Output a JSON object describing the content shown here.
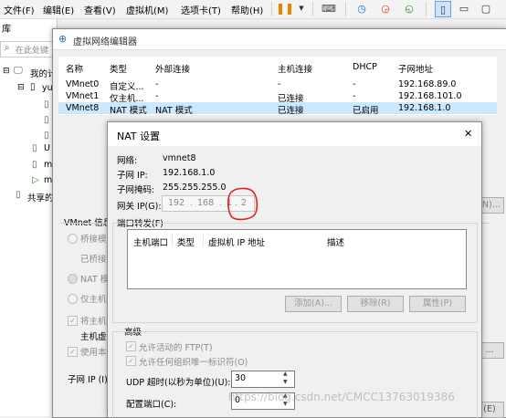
{
  "menubar": {
    "items": [
      "文件(F)",
      "编辑(E)",
      "查看(V)",
      "虚拟机(M)",
      "选项卡(T)",
      "帮助(H)"
    ]
  },
  "toolbar": {
    "pause_color": "#f07f00",
    "icons": [
      "pause-icon",
      "dropdown-icon",
      "send-keys-icon",
      "snapshot-icon",
      "revert-snapshot-icon",
      "snapshot-manager-icon",
      "library-view-icon",
      "console-view-icon",
      "fullscreen-icon"
    ]
  },
  "left_panel": {
    "header": "库",
    "search_placeholder": "在此处键",
    "tree": {
      "root": "我的计",
      "child1": "yu",
      "u": "U",
      "m1": "m",
      "m2": "m",
      "shared": "共享的"
    }
  },
  "vne": {
    "title": "虚拟网络编辑器",
    "columns": [
      "名称",
      "类型",
      "外部连接",
      "主机连接",
      "DHCP",
      "子网地址"
    ],
    "rows": [
      [
        "VMnet0",
        "自定义...",
        "-",
        "-",
        "-",
        "192.168.89.0"
      ],
      [
        "VMnet1",
        "仅主机...",
        "-",
        "已连接",
        "-",
        "192.168.101.0"
      ],
      [
        "VMnet8",
        "NAT 模式",
        "NAT 模式",
        "已连接",
        "已启用",
        "192.168.1.0"
      ]
    ],
    "info_group": "VMnet 信息",
    "bridge": "桥接模",
    "bridge_sub": "已桥接",
    "nat": "NAT 模式",
    "host_only": "仅主机",
    "connect_host": "将主机",
    "host_virtual": "主机虚",
    "use_local": "使用本地",
    "subnet_ip_label": "子网 IP (I):",
    "right_btn1": "(N)...",
    "right_btn2": "...",
    "right_btn3": "(E)"
  },
  "nat": {
    "title": "NAT 设置",
    "close": "✕",
    "network_label": "网络:",
    "network_value": "vmnet8",
    "subnet_ip_label": "子网 IP:",
    "subnet_ip_value": "192.168.1.0",
    "mask_label": "子网掩码:",
    "mask_value": "255.255.255.0",
    "gateway_label": "网关 IP(G):",
    "gateway_octets": [
      "192",
      "168",
      "1",
      "2"
    ],
    "port_forward_group": "端口转发(F)",
    "pf_columns": [
      "主机端口",
      "类型",
      "虚拟机 IP 地址",
      "描述"
    ],
    "add_btn": "添加(A)...",
    "remove_btn": "移除(R)",
    "props_btn": "属性(P)",
    "advanced_group": "高级",
    "allow_ftp": "允许活动的 FTP(T)",
    "allow_uuid": "允许任何组织唯一标识符(O)",
    "udp_label": "UDP 超时(以秒为单位)(U):",
    "udp_value": "30",
    "config_port_label": "配置端口(C):",
    "config_port_value": "0"
  },
  "watermark": "https://blog.csdn.net/CMCC13763019386",
  "annotation_color": "#e02020"
}
